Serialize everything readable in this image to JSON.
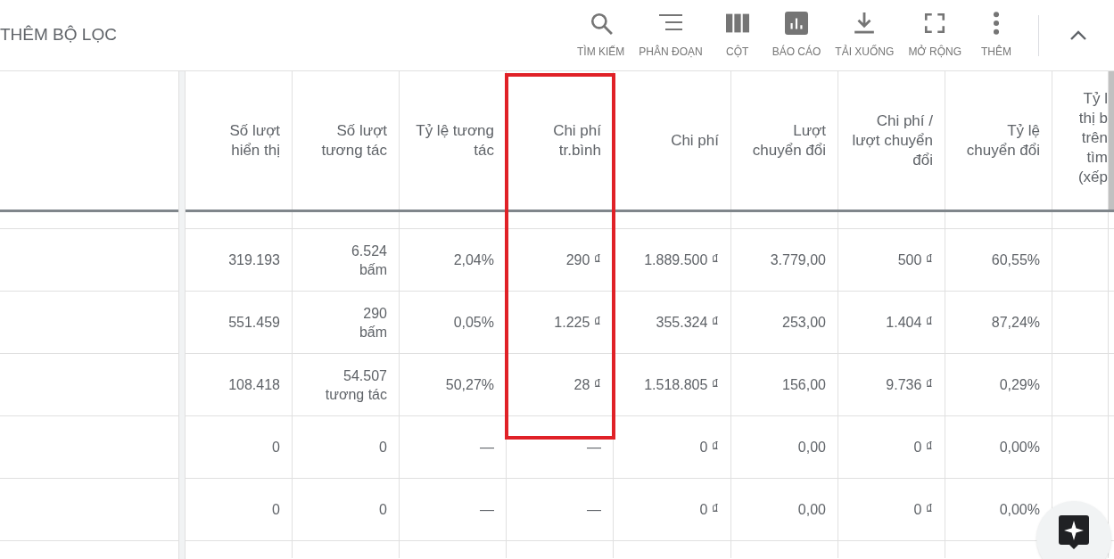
{
  "toolbar": {
    "filter_label": "THÊM BỘ LỌC",
    "actions": [
      {
        "kind": "search",
        "label": "TÌM KIẾM"
      },
      {
        "kind": "segment",
        "label": "PHÂN ĐOẠN"
      },
      {
        "kind": "columns",
        "label": "CỘT"
      },
      {
        "kind": "report",
        "label": "BÁO CÁO"
      },
      {
        "kind": "download",
        "label": "TẢI XUỐNG"
      },
      {
        "kind": "expand",
        "label": "MỞ RỘNG"
      },
      {
        "kind": "more",
        "label": "THÊM"
      }
    ]
  },
  "table": {
    "columns": [
      {
        "label": "Số lượt\nhiển thị",
        "highlighted": false
      },
      {
        "label": "Số lượt\ntương tác",
        "highlighted": false
      },
      {
        "label": "Tỷ lệ tương\ntác",
        "highlighted": false
      },
      {
        "label": "Chi phí\ntr.bình",
        "highlighted": true
      },
      {
        "label": "Chi phí",
        "highlighted": false
      },
      {
        "label": "Lượt\nchuyển đổi",
        "highlighted": false
      },
      {
        "label": "Chi phí /\nlượt chuyển\nđổi",
        "highlighted": false
      },
      {
        "label": "Tỷ lệ\nchuyển đổi",
        "highlighted": false
      },
      {
        "label": "Tỷ l\nthị b\ntrên\ntìm\n(xếp",
        "highlighted": false
      }
    ],
    "rows": [
      {
        "cells": [
          "319.193",
          "6.524\nbấm",
          "2,04%",
          "290 ₫",
          "1.889.500 ₫",
          "3.779,00",
          "500 ₫",
          "60,55%"
        ]
      },
      {
        "cells": [
          "551.459",
          "290\nbấm",
          "0,05%",
          "1.225 ₫",
          "355.324 ₫",
          "253,00",
          "1.404 ₫",
          "87,24%"
        ]
      },
      {
        "cells": [
          "108.418",
          "54.507\ntương tác",
          "50,27%",
          "28 ₫",
          "1.518.805 ₫",
          "156,00",
          "9.736 ₫",
          "0,29%"
        ]
      },
      {
        "cells": [
          "0",
          "0",
          "—",
          "—",
          "0 ₫",
          "0,00",
          "0 ₫",
          "0,00%"
        ]
      },
      {
        "cells": [
          "0",
          "0",
          "—",
          "—",
          "0 ₫",
          "0,00",
          "0 ₫",
          "0,00%"
        ]
      }
    ]
  }
}
